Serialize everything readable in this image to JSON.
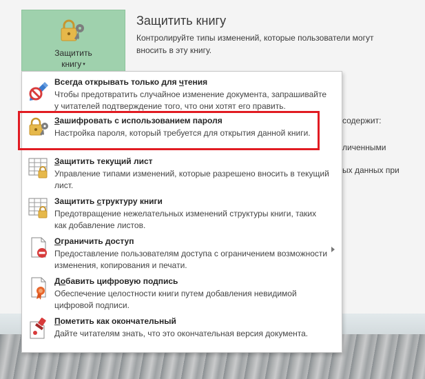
{
  "protect_button": {
    "line1": "Защитить",
    "line2": "книгу",
    "caret": "▾",
    "icon": "lock-key-icon"
  },
  "section": {
    "title": "Защитить книгу",
    "description": "Контролируйте типы изменений, которые пользователи могут вносить в эту книгу."
  },
  "background_fragments": [
    "содержит:",
    "личенными",
    "ых данных при"
  ],
  "menu": {
    "items": [
      {
        "title": "Всегда открывать только для чтения",
        "title_parts": [
          "Всегда открывать только для ",
          "ч",
          "тения"
        ],
        "desc": "Чтобы предотвратить случайное изменение документа, запрашивайте у читателей подтверждение того, что они хотят его править.",
        "icon": "pencil-no-icon"
      },
      {
        "title": "Зашифровать с использованием пароля",
        "title_parts": [
          "",
          "З",
          "ашифровать с использованием пароля"
        ],
        "desc": "Настройка пароля, который требуется для открытия данной книги.",
        "icon": "lock-key-icon"
      },
      {
        "title": "Защитить текущий лист",
        "title_parts": [
          "",
          "З",
          "ащитить текущий лист"
        ],
        "desc": "Управление типами изменений, которые разрешено вносить в текущий лист.",
        "icon": "sheet-lock-icon"
      },
      {
        "title": "Защитить структуру книги",
        "title_parts": [
          "Защитить ",
          "с",
          "труктуру книги"
        ],
        "desc": "Предотвращение нежелательных изменений структуры книги, таких как добавление листов.",
        "icon": "workbook-lock-icon"
      },
      {
        "title": "Ограничить доступ",
        "title_parts": [
          "",
          "О",
          "граничить доступ"
        ],
        "desc": "Предоставление пользователям доступа с ограничением возможности изменения, копирования и печати.",
        "icon": "document-restrict-icon"
      },
      {
        "title": "Добавить цифровую подпись",
        "title_parts": [
          "Д",
          "о",
          "бавить цифровую подпись"
        ],
        "desc": "Обеспечение целостности книги путем добавления невидимой цифровой подписи.",
        "icon": "document-ribbon-icon"
      },
      {
        "title": "Пометить как окончательный",
        "title_parts": [
          "",
          "П",
          "ометить как окончательный"
        ],
        "desc": "Дайте читателям знать, что это окончательная версия документа.",
        "icon": "document-stamp-icon"
      }
    ]
  },
  "colors": {
    "button_bg": "#9fd1ad",
    "highlight": "#e11b22",
    "lock": "#e6b84a"
  }
}
